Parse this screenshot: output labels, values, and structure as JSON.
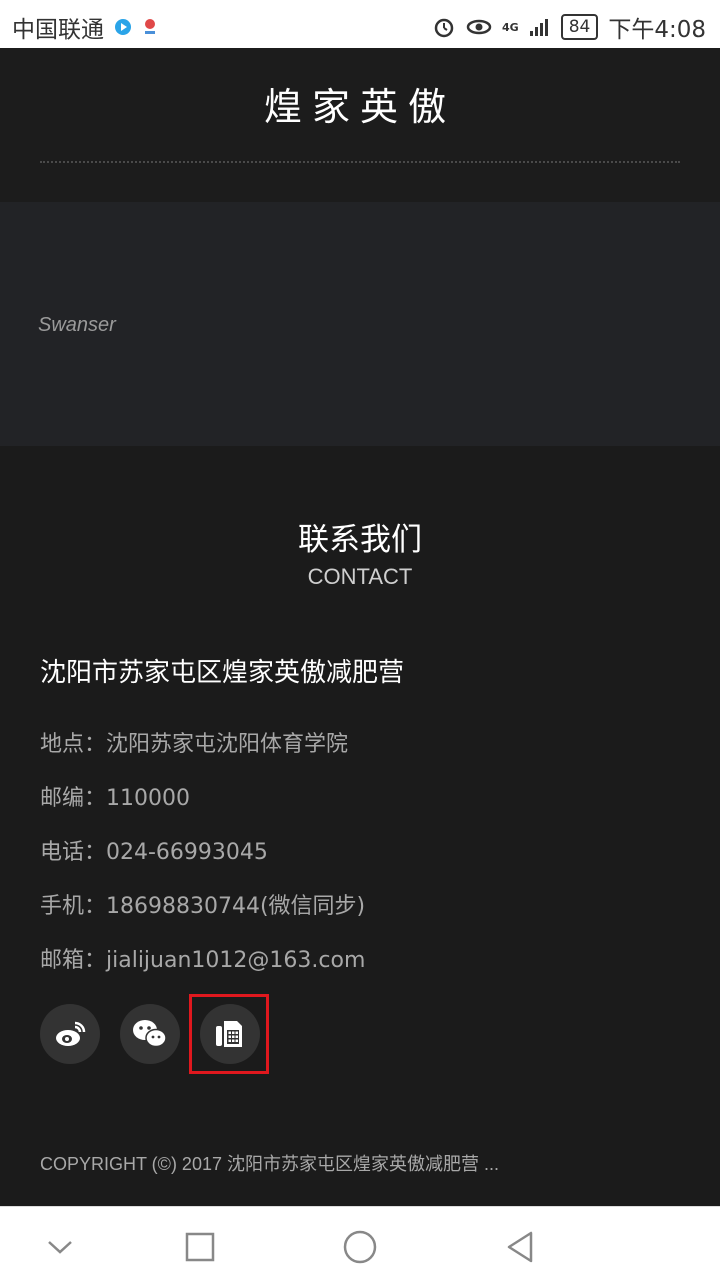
{
  "status_bar": {
    "carrier": "中国联通",
    "network": "4G",
    "battery": "84",
    "time": "下午4:08"
  },
  "header": {
    "title": "煌家英傲"
  },
  "banner": {
    "logo_text": "Swanser"
  },
  "contact": {
    "title": "联系我们",
    "subtitle": "CONTACT",
    "company": "沈阳市苏家屯区煌家英傲减肥营",
    "address": "地点：沈阳苏家屯沈阳体育学院",
    "postcode": "邮编：110000",
    "phone": "电话：024-66993045",
    "mobile": "手机：18698830744(微信同步)",
    "email": "邮箱：jialijuan1012@163.com"
  },
  "socials": [
    {
      "icon": "weibo-icon"
    },
    {
      "icon": "wechat-icon"
    },
    {
      "icon": "phone-icon",
      "highlight_color": "#e0181e"
    }
  ],
  "footer": {
    "copyright": "COPYRIGHT (©) 2017 沈阳市苏家屯区煌家英傲减肥营 ..."
  },
  "nav": {
    "icons": [
      "back-chevron-icon",
      "recent-apps-icon",
      "home-icon",
      "back-icon"
    ]
  }
}
